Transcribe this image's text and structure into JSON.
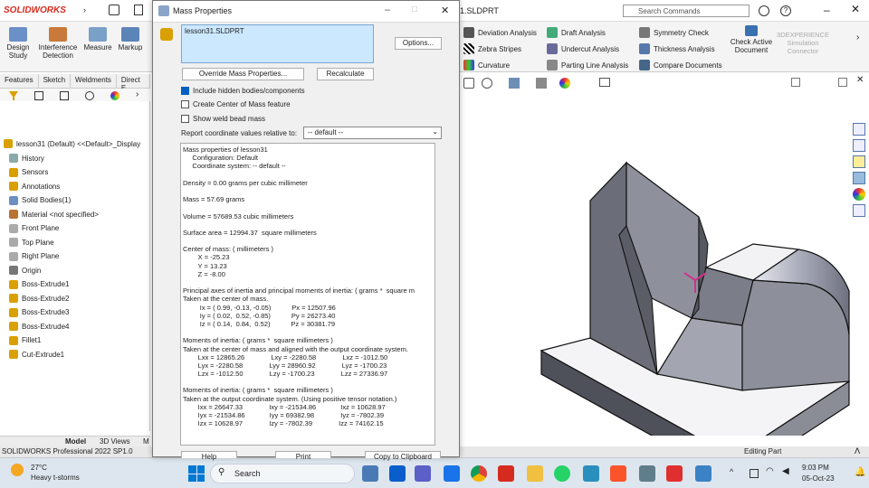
{
  "app": {
    "logo": "SOLIDWORKS",
    "document": "1.SLDPRT",
    "search_placeholder": "Search Commands"
  },
  "cmd": {
    "design_study": "Design\nStudy",
    "interference": "Interference\nDetection",
    "measure": "Measure",
    "markup": "Markup"
  },
  "eval_tools": {
    "deviation": "Deviation Analysis",
    "zebra": "Zebra Stripes",
    "curvature": "Curvature",
    "draft": "Draft Analysis",
    "undercut": "Undercut Analysis",
    "parting": "Parting Line Analysis",
    "symmetry": "Symmetry Check",
    "thickness": "Thickness Analysis",
    "compare": "Compare Documents",
    "check_active": "Check Active\nDocument",
    "simulation": "3DEXPERIENCE\nSimulation\nConnector"
  },
  "tabs": [
    "Features",
    "Sketch",
    "Weldments",
    "Direct E"
  ],
  "tree": {
    "root": "lesson31 (Default) <<Default>_Display",
    "items": [
      "History",
      "Sensors",
      "Annotations",
      "Solid Bodies(1)",
      "Material <not specified>",
      "Front Plane",
      "Top Plane",
      "Right Plane",
      "Origin",
      "Boss-Extrude1",
      "Boss-Extrude2",
      "Boss-Extrude3",
      "Boss-Extrude4",
      "Fillet1",
      "Cut-Extrude1"
    ]
  },
  "bottom_tabs": [
    "Model",
    "3D Views",
    "M"
  ],
  "status": {
    "left": "SOLIDWORKS Professional 2022 SP1.0",
    "right": "Editing Part"
  },
  "dialog": {
    "title": "Mass Properties",
    "selection": "lesson31.SLDPRT",
    "options": "Options...",
    "override": "Override Mass Properties...",
    "recalc": "Recalculate",
    "cb_hidden": "Include hidden bodies/components",
    "cb_com": "Create Center of Mass feature",
    "cb_weld": "Show weld bead mass",
    "coord_label": "Report coordinate values relative to:",
    "coord_value": "-- default --",
    "lines": [
      "Mass properties of lesson31",
      "     Configuration: Default",
      "     Coordinate system: -- default --",
      "",
      "Density = 0.00 grams per cubic millimeter",
      "",
      "Mass = 57.69 grams",
      "",
      "Volume = 57689.53 cubic millimeters",
      "",
      "Surface area = 12994.37  square millimeters",
      "",
      "Center of mass: ( millimeters )",
      "        X = -25.23",
      "        Y = 13.23",
      "        Z = -8.00",
      "",
      "Principal axes of inertia and principal moments of inertia: ( grams *  square m",
      "Taken at the center of mass.",
      "         Ix = ( 0.99, -0.13, -0.05)           Px = 12507.96",
      "         Iy = ( 0.02,  0.52, -0.85)           Py = 26273.40",
      "         Iz = ( 0.14,  0.84,  0.52)           Pz = 30381.79",
      "",
      "Moments of inertia: ( grams *  square millimeters )",
      "Taken at the center of mass and aligned with the output coordinate system.",
      "        Lxx = 12865.26              Lxy = -2280.58              Lxz = -1012.50",
      "        Lyx = -2280.58              Lyy = 28960.92              Lyz = -1700.23",
      "        Lzx = -1012.50              Lzy = -1700.23              Lzz = 27336.97",
      "",
      "Moments of inertia: ( grams *  square millimeters )",
      "Taken at the output coordinate system. (Using positive tensor notation.)",
      "        Ixx = 26647.33              Ixy = -21534.86             Ixz = 10628.97",
      "        Iyx = -21534.86             Iyy = 69382.98              Iyz = -7802.39",
      "        Izx = 10628.97              Izy = -7802.39              Izz = 74162.15"
    ],
    "help": "Help",
    "print": "Print",
    "copy": "Copy to Clipboard"
  },
  "taskbar": {
    "temp": "27°C",
    "weather": "Heavy t-storms",
    "search": "Search",
    "time": "9:03 PM",
    "date": "05-Oct-23"
  }
}
